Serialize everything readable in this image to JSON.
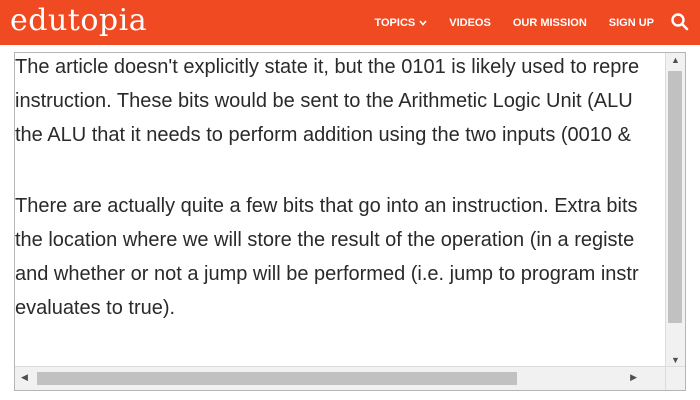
{
  "brand": {
    "logo_text": "edutopia",
    "color": "#f04a23"
  },
  "nav": {
    "items": [
      {
        "label": "TOPICS",
        "has_dropdown": true
      },
      {
        "label": "VIDEOS"
      },
      {
        "label": "OUR MISSION"
      },
      {
        "label": "SIGN UP"
      }
    ],
    "search_icon": "search-icon"
  },
  "content": {
    "paragraphs": [
      {
        "lines": [
          "The article doesn't explicitly state it, but the 0101 is likely used to repre",
          "instruction. These bits would be sent to the Arithmetic Logic Unit (ALU",
          "the ALU that it needs to perform addition using the two inputs (0010 &"
        ]
      },
      {
        "lines": [
          "There are actually quite a few bits that go into an instruction. Extra bits",
          "the location where we will store the result of the operation (in a registe",
          "and whether or not a jump will be performed (i.e. jump to program instr",
          "evaluates to true)."
        ]
      }
    ]
  }
}
